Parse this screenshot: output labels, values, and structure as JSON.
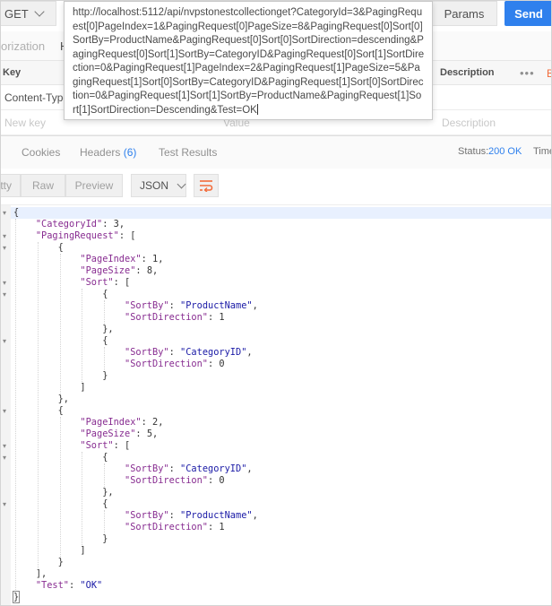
{
  "request": {
    "method": "GET",
    "url": "http://localhost:5112/api/nvpstonestcollectionget?CategoryId=3&PagingRequest[0]PageIndex=1&PagingRequest[0]PageSize=8&PagingRequest[0]Sort[0]SortBy=ProductName&PagingRequest[0]Sort[0]SortDirection=descending&PagingRequest[0]Sort[1]SortBy=CategoryID&PagingRequest[0]Sort[1]SortDirection=0&PagingRequest[1]PageIndex=2&PagingRequest[1]PageSize=5&PagingRequest[1]Sort[0]SortBy=CategoryID&PagingRequest[1]Sort[0]SortDirection=0&PagingRequest[1]Sort[1]SortBy=ProductName&PagingRequest[1]Sort[1]SortDirection=Descending&Test=OK",
    "params_label": "Params",
    "send_label": "Send",
    "tabs": [
      "orization",
      "H"
    ]
  },
  "headers_table": {
    "key_label": "Key",
    "description_label": "Description",
    "more_label": "•••",
    "bulk_label": "B",
    "rows": [
      {
        "key": "Content-Type",
        "placeholder": false
      },
      {
        "key": "New key",
        "value": "Value",
        "description": "Description",
        "placeholder": true
      }
    ]
  },
  "response": {
    "tabs": [
      {
        "label": "Cookies"
      },
      {
        "label": "Headers",
        "count": "(6)"
      },
      {
        "label": "Test Results"
      }
    ],
    "status_label": "Status:",
    "status_value": "200 OK",
    "time_label": "Time",
    "view_modes": [
      "tty",
      "Raw",
      "Preview"
    ],
    "format": "JSON"
  },
  "body_lines": [
    {
      "indent": 0,
      "parts": [
        [
          "pun",
          "{"
        ]
      ],
      "fold": true,
      "hl": true
    },
    {
      "indent": 1,
      "parts": [
        [
          "key",
          "\"CategoryId\""
        ],
        [
          "pun",
          ": "
        ],
        [
          "num",
          "3"
        ],
        [
          "pun",
          ","
        ]
      ]
    },
    {
      "indent": 1,
      "parts": [
        [
          "key",
          "\"PagingRequest\""
        ],
        [
          "pun",
          ": ["
        ]
      ],
      "fold": true
    },
    {
      "indent": 2,
      "parts": [
        [
          "pun",
          "{"
        ]
      ],
      "fold": true
    },
    {
      "indent": 3,
      "parts": [
        [
          "key",
          "\"PageIndex\""
        ],
        [
          "pun",
          ": "
        ],
        [
          "num",
          "1"
        ],
        [
          "pun",
          ","
        ]
      ]
    },
    {
      "indent": 3,
      "parts": [
        [
          "key",
          "\"PageSize\""
        ],
        [
          "pun",
          ": "
        ],
        [
          "num",
          "8"
        ],
        [
          "pun",
          ","
        ]
      ]
    },
    {
      "indent": 3,
      "parts": [
        [
          "key",
          "\"Sort\""
        ],
        [
          "pun",
          ": ["
        ]
      ],
      "fold": true
    },
    {
      "indent": 4,
      "parts": [
        [
          "pun",
          "{"
        ]
      ],
      "fold": true
    },
    {
      "indent": 5,
      "parts": [
        [
          "key",
          "\"SortBy\""
        ],
        [
          "pun",
          ": "
        ],
        [
          "str",
          "\"ProductName\""
        ],
        [
          "pun",
          ","
        ]
      ]
    },
    {
      "indent": 5,
      "parts": [
        [
          "key",
          "\"SortDirection\""
        ],
        [
          "pun",
          ": "
        ],
        [
          "num",
          "1"
        ]
      ]
    },
    {
      "indent": 4,
      "parts": [
        [
          "pun",
          "},"
        ]
      ]
    },
    {
      "indent": 4,
      "parts": [
        [
          "pun",
          "{"
        ]
      ],
      "fold": true
    },
    {
      "indent": 5,
      "parts": [
        [
          "key",
          "\"SortBy\""
        ],
        [
          "pun",
          ": "
        ],
        [
          "str",
          "\"CategoryID\""
        ],
        [
          "pun",
          ","
        ]
      ]
    },
    {
      "indent": 5,
      "parts": [
        [
          "key",
          "\"SortDirection\""
        ],
        [
          "pun",
          ": "
        ],
        [
          "num",
          "0"
        ]
      ]
    },
    {
      "indent": 4,
      "parts": [
        [
          "pun",
          "}"
        ]
      ]
    },
    {
      "indent": 3,
      "parts": [
        [
          "pun",
          "]"
        ]
      ]
    },
    {
      "indent": 2,
      "parts": [
        [
          "pun",
          "},"
        ]
      ]
    },
    {
      "indent": 2,
      "parts": [
        [
          "pun",
          "{"
        ]
      ],
      "fold": true
    },
    {
      "indent": 3,
      "parts": [
        [
          "key",
          "\"PageIndex\""
        ],
        [
          "pun",
          ": "
        ],
        [
          "num",
          "2"
        ],
        [
          "pun",
          ","
        ]
      ]
    },
    {
      "indent": 3,
      "parts": [
        [
          "key",
          "\"PageSize\""
        ],
        [
          "pun",
          ": "
        ],
        [
          "num",
          "5"
        ],
        [
          "pun",
          ","
        ]
      ]
    },
    {
      "indent": 3,
      "parts": [
        [
          "key",
          "\"Sort\""
        ],
        [
          "pun",
          ": ["
        ]
      ],
      "fold": true
    },
    {
      "indent": 4,
      "parts": [
        [
          "pun",
          "{"
        ]
      ],
      "fold": true
    },
    {
      "indent": 5,
      "parts": [
        [
          "key",
          "\"SortBy\""
        ],
        [
          "pun",
          ": "
        ],
        [
          "str",
          "\"CategoryID\""
        ],
        [
          "pun",
          ","
        ]
      ]
    },
    {
      "indent": 5,
      "parts": [
        [
          "key",
          "\"SortDirection\""
        ],
        [
          "pun",
          ": "
        ],
        [
          "num",
          "0"
        ]
      ]
    },
    {
      "indent": 4,
      "parts": [
        [
          "pun",
          "},"
        ]
      ]
    },
    {
      "indent": 4,
      "parts": [
        [
          "pun",
          "{"
        ]
      ],
      "fold": true
    },
    {
      "indent": 5,
      "parts": [
        [
          "key",
          "\"SortBy\""
        ],
        [
          "pun",
          ": "
        ],
        [
          "str",
          "\"ProductName\""
        ],
        [
          "pun",
          ","
        ]
      ]
    },
    {
      "indent": 5,
      "parts": [
        [
          "key",
          "\"SortDirection\""
        ],
        [
          "pun",
          ": "
        ],
        [
          "num",
          "1"
        ]
      ]
    },
    {
      "indent": 4,
      "parts": [
        [
          "pun",
          "}"
        ]
      ]
    },
    {
      "indent": 3,
      "parts": [
        [
          "pun",
          "]"
        ]
      ]
    },
    {
      "indent": 2,
      "parts": [
        [
          "pun",
          "}"
        ]
      ]
    },
    {
      "indent": 1,
      "parts": [
        [
          "pun",
          "],"
        ]
      ]
    },
    {
      "indent": 1,
      "parts": [
        [
          "key",
          "\"Test\""
        ],
        [
          "pun",
          ": "
        ],
        [
          "str",
          "\"OK\""
        ]
      ]
    },
    {
      "indent": 0,
      "parts": [
        [
          "pun",
          "}"
        ]
      ],
      "boxed": true
    }
  ],
  "colors": {
    "accent": "#2f80ed",
    "orange": "#f26b3a",
    "json_key": "#882d91",
    "json_string": "#1a1aa6"
  }
}
